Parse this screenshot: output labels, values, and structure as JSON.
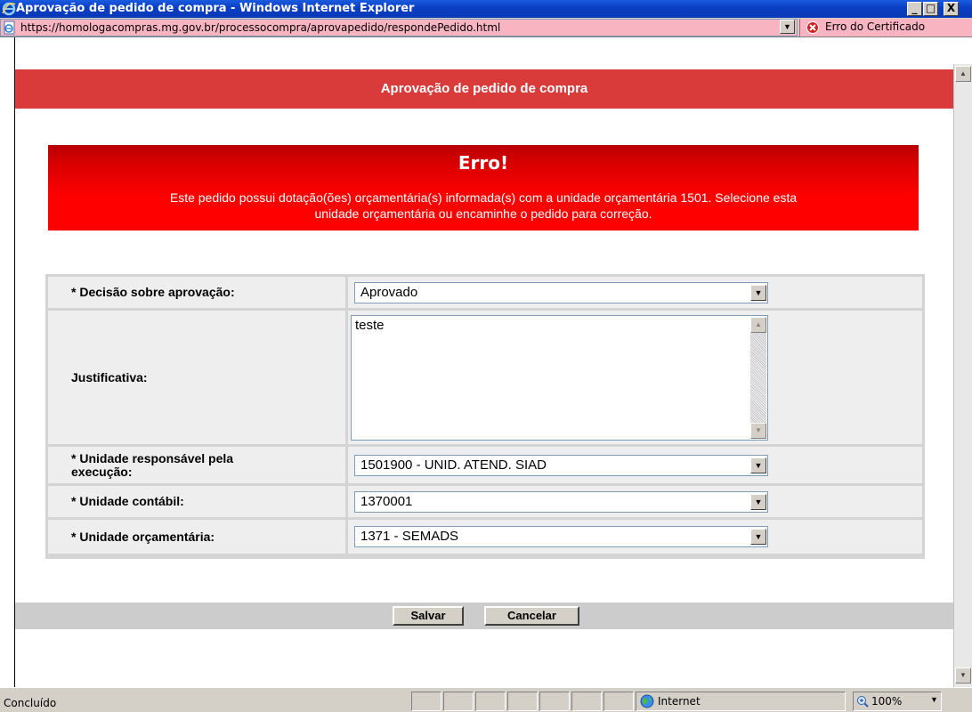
{
  "window": {
    "title": "Aprovação de pedido de compra - Windows Internet Explorer",
    "minimize_glyph": "_",
    "maximize_glyph": "□",
    "close_glyph": "X"
  },
  "address_bar": {
    "url": "https://homologacompras.mg.gov.br/processocompra/aprovapedido/respondePedido.html",
    "certificate_error": "Erro do Certificado"
  },
  "page": {
    "header_title": "Aprovação de pedido de compra",
    "error": {
      "title": "Erro!",
      "line1": "Este pedido possui dotação(ões) orçamentária(s) informada(s) com a unidade orçamentária 1501. Selecione esta",
      "line2": "unidade orçamentária ou encaminhe o pedido para correção."
    },
    "form": {
      "decisao": {
        "label": "* Decisão sobre aprovação:",
        "value": "Aprovado"
      },
      "justificativa": {
        "label": "Justificativa:",
        "value": "teste"
      },
      "unidade_responsavel": {
        "label_line1": "* Unidade responsável pela",
        "label_line2": "execução:",
        "value": "1501900 - UNID. ATEND. SIAD"
      },
      "unidade_contabil": {
        "label": "* Unidade contábil:",
        "value": "1370001"
      },
      "unidade_orcamentaria": {
        "label": "* Unidade orçamentária:",
        "value": "1371 - SEMADS"
      }
    },
    "buttons": {
      "save": "Salvar",
      "cancel": "Cancelar"
    }
  },
  "status_bar": {
    "status": "Concluído",
    "zone": "Internet",
    "zoom": "100%"
  },
  "colors": {
    "header_red": "#d93a3a",
    "error_red": "#ff0000",
    "address_error_pink": "#f8b4c0",
    "titlebar_blue": "#0a3ec2"
  },
  "icons": [
    "ie-logo-icon",
    "page-icon",
    "certificate-error-icon",
    "dropdown-arrow-icon",
    "globe-icon",
    "zoom-icon"
  ]
}
